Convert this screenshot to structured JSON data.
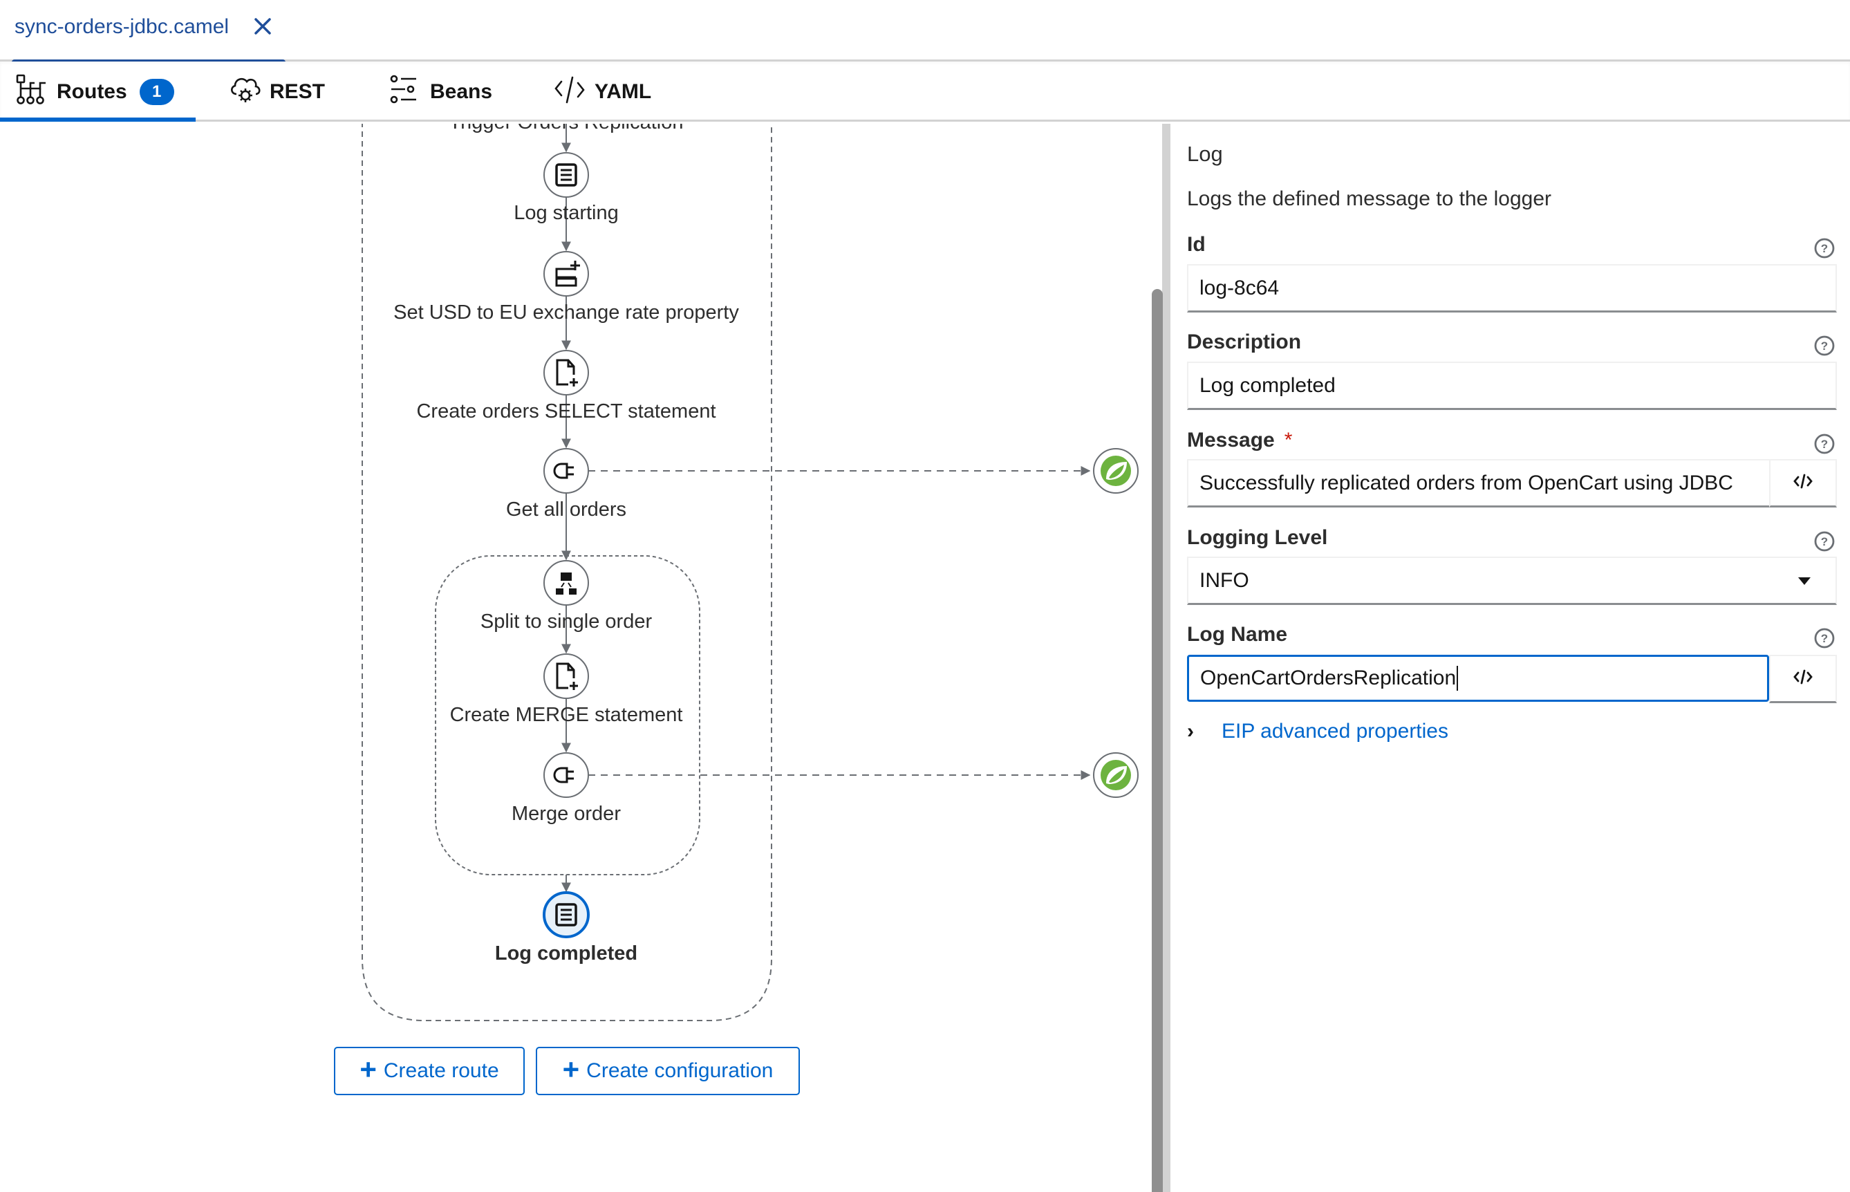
{
  "file_tab": {
    "label": "sync-orders-jdbc.camel",
    "close_icon": "close-icon"
  },
  "view_tabs": [
    {
      "label": "Routes",
      "icon": "routes-icon",
      "badge": "1",
      "active": true
    },
    {
      "label": "REST",
      "icon": "cloud-gear-icon",
      "active": false
    },
    {
      "label": "Beans",
      "icon": "beans-settings-icon",
      "active": false
    },
    {
      "label": "YAML",
      "icon": "code-icon",
      "active": false
    }
  ],
  "canvas": {
    "route_header_label": "Trigger Orders Replication",
    "nodes": [
      {
        "label": "Log starting",
        "icon": "log-icon",
        "selected": false
      },
      {
        "label": "Set USD to EU exchange rate property",
        "icon": "set-property-icon",
        "selected": false
      },
      {
        "label": "Create orders SELECT statement",
        "icon": "set-body-icon",
        "selected": false
      },
      {
        "label": "Get all orders",
        "icon": "plug-icon",
        "selected": false
      },
      {
        "label": "Split to single order",
        "icon": "split-icon",
        "selected": false
      },
      {
        "label": "Create MERGE statement",
        "icon": "set-body-icon",
        "selected": false
      },
      {
        "label": "Merge order",
        "icon": "plug-icon",
        "selected": false
      },
      {
        "label": "Log completed",
        "icon": "log-icon",
        "selected": true
      }
    ],
    "external_endpoints": [
      {
        "icon": "spring-icon",
        "connected_to": "Get all orders"
      },
      {
        "icon": "spring-icon",
        "connected_to": "Merge order"
      }
    ],
    "buttons": {
      "create_route": "Create route",
      "create_configuration": "Create configuration"
    }
  },
  "panel": {
    "title": "Log",
    "description": "Logs the defined message to the logger",
    "fields": {
      "id": {
        "label": "Id",
        "value": "log-8c64"
      },
      "description": {
        "label": "Description",
        "value": "Log completed"
      },
      "message": {
        "label": "Message",
        "required_marker": "*",
        "value": "Successfully replicated orders from OpenCart using JDBC"
      },
      "logging_level": {
        "label": "Logging Level",
        "value": "INFO"
      },
      "log_name": {
        "label": "Log Name",
        "value": "OpenCartOrdersReplication"
      }
    },
    "advanced_toggle": "EIP advanced properties"
  },
  "colors": {
    "accent": "#0066cc",
    "file_tab_accent": "#1f4e9a",
    "spring_green": "#6db33f",
    "required": "#c9190b"
  }
}
